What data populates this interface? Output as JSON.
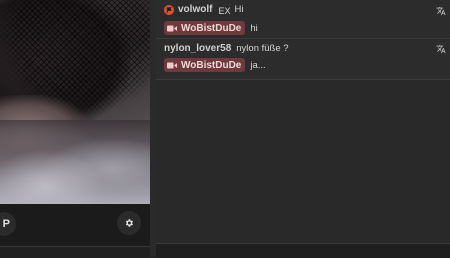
{
  "video": {
    "control_left_label": "P"
  },
  "chat": {
    "messages": [
      {
        "username": "volwolf",
        "superscript": "EX",
        "text": "Hi",
        "reply_name": "WoBistDuDe",
        "reply_text": "hi"
      },
      {
        "username": "nylon_lover58",
        "text": "nylon füße ?",
        "reply_name": "WoBistDuDe",
        "reply_text": "ja..."
      }
    ]
  },
  "colors": {
    "streamer_tag_bg": "#6d3b3e",
    "flag_red": "#d9542f",
    "chat_bg": "#282727"
  },
  "icons": [
    "flag-icon",
    "camera-icon",
    "translate-icon",
    "gear-icon"
  ]
}
